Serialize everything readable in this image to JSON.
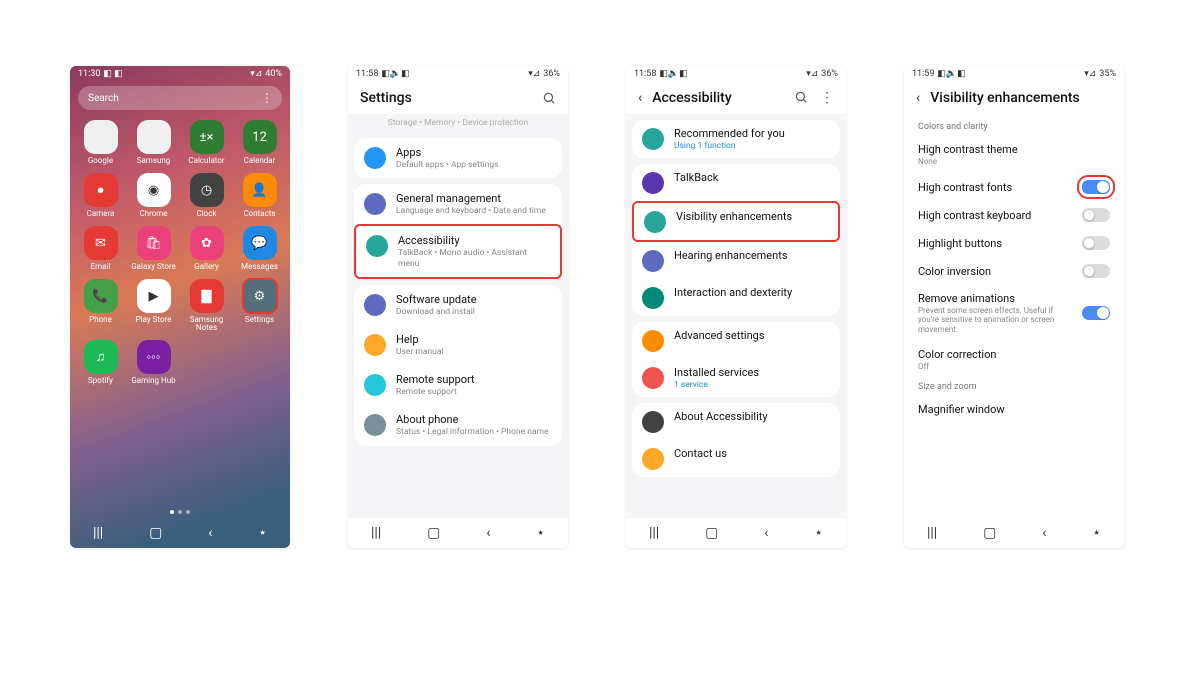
{
  "screen1": {
    "status": {
      "time": "11:30",
      "icons": "◧ ◧",
      "battery": "40%",
      "signal": "▾ ⊿"
    },
    "search_placeholder": "Search",
    "apps": [
      {
        "label": "Google",
        "bg": "#f0f0f0"
      },
      {
        "label": "Samsung",
        "bg": "#f0f0f0"
      },
      {
        "label": "Calculator",
        "bg": "#2e7d32"
      },
      {
        "label": "Calendar",
        "bg": "#2e7d32",
        "text": "12"
      },
      {
        "label": "Camera",
        "bg": "#e53935"
      },
      {
        "label": "Chrome",
        "bg": "#fff"
      },
      {
        "label": "Clock",
        "bg": "#424242"
      },
      {
        "label": "Contacts",
        "bg": "#fb8c00"
      },
      {
        "label": "Email",
        "bg": "#e53935"
      },
      {
        "label": "Galaxy Store",
        "bg": "#ec407a"
      },
      {
        "label": "Gallery",
        "bg": "#ec407a"
      },
      {
        "label": "Messages",
        "bg": "#1e88e5"
      },
      {
        "label": "Phone",
        "bg": "#43a047"
      },
      {
        "label": "Play Store",
        "bg": "#fff"
      },
      {
        "label": "Samsung Notes",
        "bg": "#e53935"
      },
      {
        "label": "Settings",
        "bg": "#546e7a",
        "highlight": true
      },
      {
        "label": "Spotify",
        "bg": "#1db954"
      },
      {
        "label": "Gaming Hub",
        "bg": "#7b1fa2"
      }
    ]
  },
  "screen2": {
    "status": {
      "time": "11:58",
      "icons": "◧ 🔊 ◧",
      "battery": "36%",
      "signal": "▾ ⊿"
    },
    "title": "Settings",
    "truncated": "Storage  •  Memory  •  Device protection",
    "items": [
      {
        "title": "Apps",
        "sub": "Default apps  •  App settings",
        "color": "#2196f3",
        "card": 1
      },
      {
        "title": "General management",
        "sub": "Language and keyboard  •  Date and time",
        "color": "#5c6bc0",
        "card": 2
      },
      {
        "title": "Accessibility",
        "sub": "TalkBack  •  Mono audio  •  Assistant menu",
        "color": "#26a69a",
        "card": 2,
        "highlight": true
      },
      {
        "title": "Software update",
        "sub": "Download and install",
        "color": "#5c6bc0",
        "card": 3
      },
      {
        "title": "Help",
        "sub": "User manual",
        "color": "#ffa726",
        "card": 3
      },
      {
        "title": "Remote support",
        "sub": "Remote support",
        "color": "#26c6da",
        "card": 3
      },
      {
        "title": "About phone",
        "sub": "Status  •  Legal information  •  Phone name",
        "color": "#78909c",
        "card": 3
      }
    ]
  },
  "screen3": {
    "status": {
      "time": "11:58",
      "icons": "◧ 🔊 ◧",
      "battery": "36%",
      "signal": "▾ ⊿"
    },
    "title": "Accessibility",
    "items": [
      {
        "title": "Recommended for you",
        "sub": "Using 1 function",
        "sublink": true,
        "color": "#26a69a",
        "card": 1
      },
      {
        "title": "TalkBack",
        "color": "#5e35b1",
        "card": 2
      },
      {
        "title": "Visibility enhancements",
        "color": "#26a69a",
        "card": 2,
        "highlight": true
      },
      {
        "title": "Hearing enhancements",
        "color": "#5c6bc0",
        "card": 2
      },
      {
        "title": "Interaction and dexterity",
        "color": "#00897b",
        "card": 2
      },
      {
        "title": "Advanced settings",
        "color": "#fb8c00",
        "card": 3
      },
      {
        "title": "Installed services",
        "sub": "1 service",
        "sublink": true,
        "color": "#ef5350",
        "card": 3
      },
      {
        "title": "About Accessibility",
        "color": "#424242",
        "card": 4
      },
      {
        "title": "Contact us",
        "color": "#ffa726",
        "card": 4
      }
    ]
  },
  "screen4": {
    "status": {
      "time": "11:59",
      "icons": "◧ 🔊 ◧",
      "battery": "35%",
      "signal": "▾ ⊿"
    },
    "title": "Visibility enhancements",
    "section1": "Colors and clarity",
    "settings": [
      {
        "title": "High contrast theme",
        "sub": "None",
        "toggle": null
      },
      {
        "title": "High contrast fonts",
        "toggle": true,
        "highlight": true
      },
      {
        "title": "High contrast keyboard",
        "toggle": false
      },
      {
        "title": "Highlight buttons",
        "toggle": false
      },
      {
        "title": "Color inversion",
        "toggle": false
      },
      {
        "title": "Remove animations",
        "sub": "Prevent some screen effects. Useful if you're sensitive to animation or screen movement.",
        "toggle": true
      },
      {
        "title": "Color correction",
        "sub": "Off",
        "toggle": null
      }
    ],
    "section2": "Size and zoom",
    "settings2": [
      {
        "title": "Magnifier window"
      }
    ]
  }
}
